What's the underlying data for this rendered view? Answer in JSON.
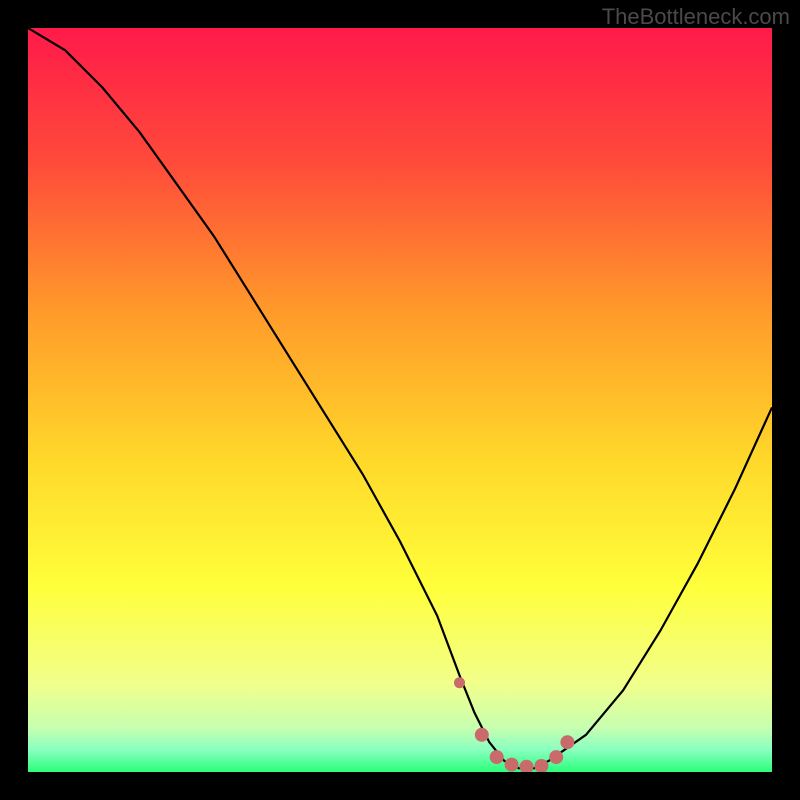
{
  "watermark": "TheBottleneck.com",
  "chart_data": {
    "type": "line",
    "title": "",
    "xlabel": "",
    "ylabel": "",
    "xlim": [
      0,
      100
    ],
    "ylim": [
      0,
      100
    ],
    "series": [
      {
        "name": "bottleneck-curve",
        "x": [
          0,
          5,
          10,
          15,
          20,
          25,
          30,
          35,
          40,
          45,
          50,
          55,
          58,
          60,
          62,
          64,
          66,
          68,
          70,
          75,
          80,
          85,
          90,
          95,
          100
        ],
        "y": [
          100,
          97,
          92,
          86,
          79,
          72,
          64,
          56,
          48,
          40,
          31,
          21,
          13,
          8,
          4,
          1.5,
          0.5,
          0.5,
          1.5,
          5,
          11,
          19,
          28,
          38,
          49
        ]
      }
    ],
    "highlight": {
      "name": "optimal-zone-markers",
      "x": [
        58,
        61,
        63,
        65,
        67,
        69,
        71,
        72.5
      ],
      "y": [
        12,
        5,
        2,
        1,
        0.7,
        0.8,
        2,
        4
      ],
      "color": "#c96b6b"
    },
    "gradient": {
      "top": "#ff1a4a",
      "mid_upper": "#ff9a2a",
      "mid": "#ffe52a",
      "mid_lower": "#f7ff7a",
      "bottom": "#2aff7a"
    }
  }
}
